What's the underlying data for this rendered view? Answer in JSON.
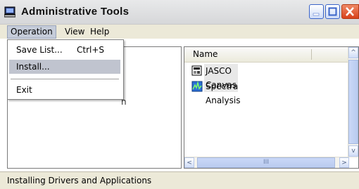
{
  "window": {
    "title": "Administrative Tools",
    "icon": "computer-monitor-icon"
  },
  "menubar": {
    "items": [
      {
        "label": "Operation"
      },
      {
        "label": "View"
      },
      {
        "label": "Help"
      }
    ]
  },
  "dropdown": {
    "items": [
      {
        "label": "Save List...",
        "shortcut": "Ctrl+S"
      },
      {
        "label": "Install...",
        "highlighted": true
      },
      {
        "label": "Exit"
      }
    ]
  },
  "listview": {
    "column": "Name",
    "rows": [
      {
        "label": "JASCO Canvas",
        "icon": "canvas-app-icon",
        "selected": true
      },
      {
        "label": "Spectra Analysis",
        "icon": "spectra-chart-icon"
      }
    ]
  },
  "scroll": {
    "up": "^",
    "down": "v",
    "left": "<",
    "right": ">",
    "grip": "III"
  },
  "status": {
    "text": "Installing Drivers and Applications"
  }
}
